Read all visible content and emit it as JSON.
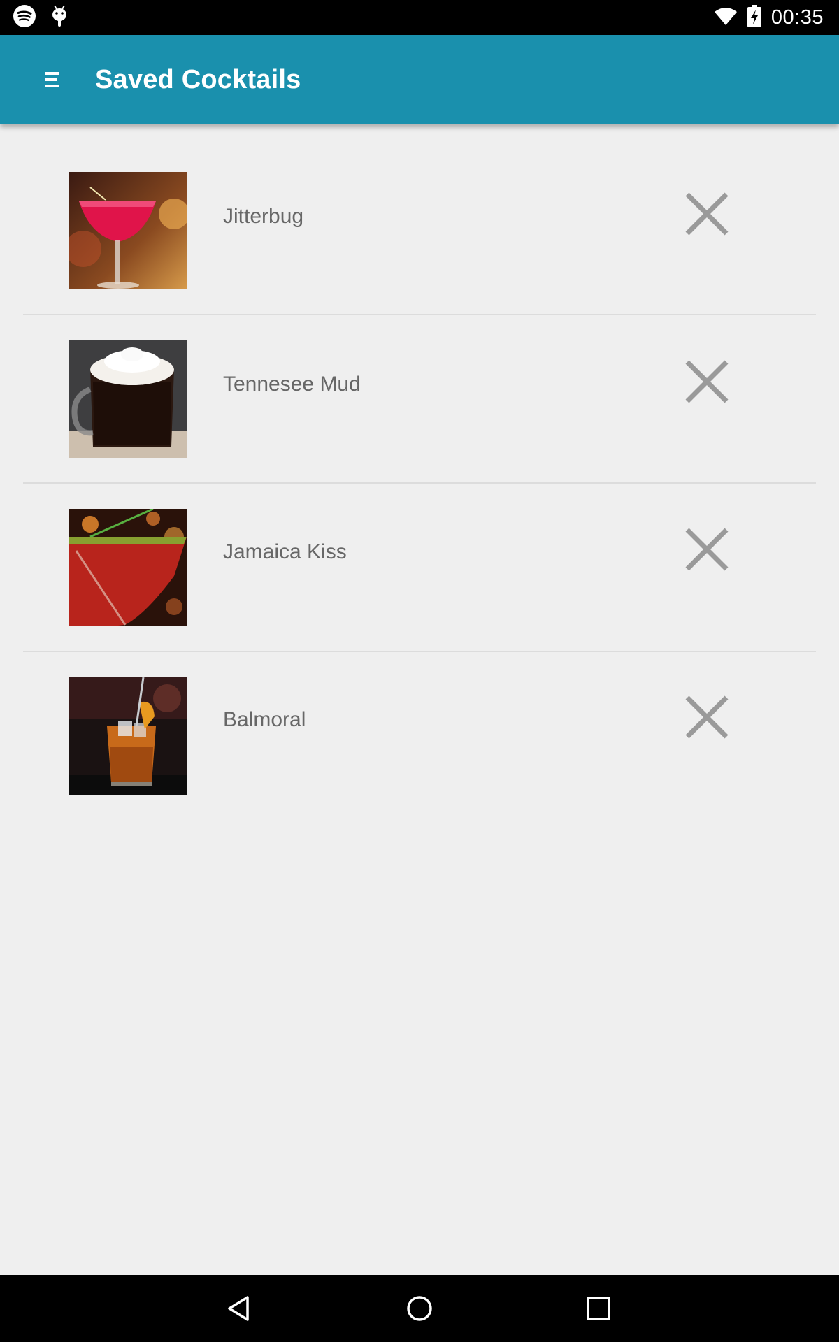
{
  "status_bar": {
    "time": "00:35",
    "left_icons": [
      "spotify-icon",
      "android-debug-icon"
    ],
    "right_icons": [
      "wifi-icon",
      "battery-charging-icon"
    ]
  },
  "app_bar": {
    "title": "Saved Cocktails",
    "menu_icon": "hamburger-menu-icon",
    "color": "#1a90ad"
  },
  "cocktails": [
    {
      "name": "Jitterbug",
      "remove_icon": "close-icon"
    },
    {
      "name": "Tennesee Mud",
      "remove_icon": "close-icon"
    },
    {
      "name": "Jamaica Kiss",
      "remove_icon": "close-icon"
    },
    {
      "name": "Balmoral",
      "remove_icon": "close-icon"
    }
  ],
  "nav_bar": {
    "buttons": [
      "back-icon",
      "home-icon",
      "recents-icon"
    ]
  }
}
